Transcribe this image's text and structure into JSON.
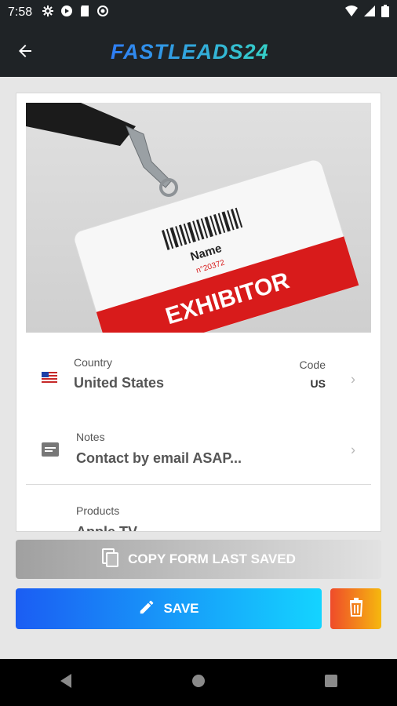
{
  "status_bar": {
    "time": "7:58"
  },
  "app_bar": {
    "brand": "FASTLEADS24",
    "brand_colors": [
      "#2f7df4",
      "#35d0c7"
    ]
  },
  "badge_image": {
    "barcode_text": "Name",
    "serial_text": "n°20372",
    "banner_text": "EXHIBITOR",
    "banner_color": "#d81b1b"
  },
  "fields": {
    "country": {
      "label": "Country",
      "value": "United States",
      "code_label": "Code",
      "code_value": "US"
    },
    "notes": {
      "label": "Notes",
      "value": "Contact by email ASAP..."
    },
    "products": {
      "label": "Products",
      "value": "Apple TV"
    }
  },
  "buttons": {
    "copy_label": "COPY FORM LAST SAVED",
    "save_label": "SAVE"
  },
  "nav": {
    "icons": [
      "back-icon",
      "home-icon",
      "recents-icon"
    ]
  }
}
